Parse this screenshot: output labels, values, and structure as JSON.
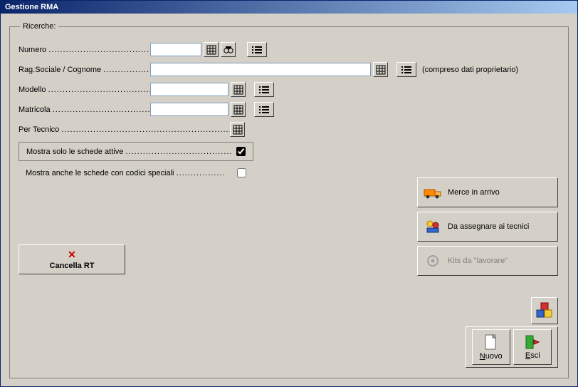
{
  "window": {
    "title": "Gestione RMA"
  },
  "fieldset": {
    "legend": "Ricerche:"
  },
  "labels": {
    "numero": "Numero",
    "ragsoc": "Rag.Sociale / Cognome",
    "modello": "Modello",
    "matricola": "Matricola",
    "tecnico": "Per Tecnico",
    "hint_proprietario": "(compreso dati proprietario)",
    "mostra_attive": "Mostra solo le schede attive",
    "mostra_speciali": "Mostra anche le schede con codici speciali"
  },
  "values": {
    "numero": "",
    "ragsoc": "",
    "modello": "",
    "matricola": "",
    "mostra_attive_checked": true,
    "mostra_speciali_checked": false
  },
  "buttons": {
    "cancella_rt": "Cancella RT",
    "merce_in_arrivo": "Merce in arrivo",
    "da_assegnare": "Da assegnare ai tecnici",
    "kits_lavorare": "Kits da \"lavorare\"",
    "nuovo": "Nuovo",
    "esci": "Esci"
  },
  "dots": "....................................................................."
}
